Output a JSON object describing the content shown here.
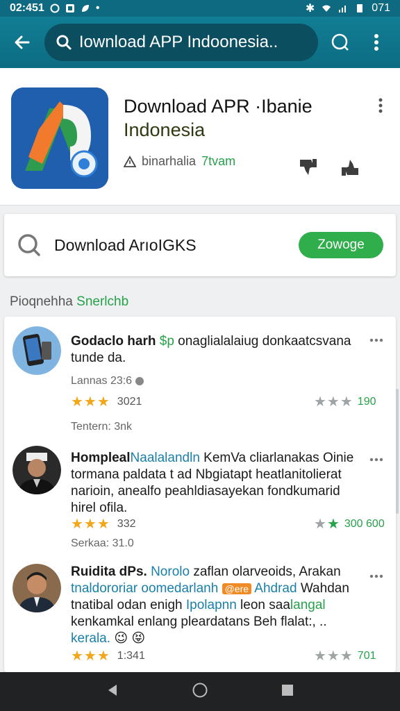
{
  "status": {
    "time": "02:451",
    "battery": "071"
  },
  "appbar": {
    "search_text": "Iownload APP Indoonesia.."
  },
  "app": {
    "title_line1": "Download APR ·Ibanie",
    "title_line2": "Indonesia",
    "meta_text": "binarhalia",
    "meta_highlight": "7tvam"
  },
  "download": {
    "label": "Download ArıoIGKS",
    "button": "Zowoge"
  },
  "section": {
    "title_prefix": "Pioqnehha",
    "title_highlight": "Snerlchb"
  },
  "reviews": [
    {
      "name": "Godaclo harh",
      "highlight": "$p",
      "text": " onaglialalaiug donkaatcsvana tunde da.",
      "meta": "Lannas 23:6",
      "left_rating": "3021",
      "right_rating": "190",
      "footer": "Tentern: 3nk"
    },
    {
      "name": "Hompleal",
      "highlight": "Naalalandln",
      "text": " KemVa cliarlanakas Oinie tormana paldata t ad Nbgiatapt heatlanitolierat narioin, anealfo peahldiasayekan fondkumarid hirel ofila.",
      "meta": "",
      "left_rating": "332",
      "right_rating": "300 600",
      "footer": "Serkaa: 31.0"
    },
    {
      "name": "Ruidita dPs.",
      "highlight": "Norolo",
      "text": " zaflan olarveoids, Arakan",
      "line2_blue": "tnaldororiar oomedarlanh",
      "badge": "@ere",
      "line2_blue2": "Ahdrad",
      "line2_rest": " Wahdan",
      "line3": "tnatibal odan enigh",
      "line3_blue": "Ipolapnn",
      "line3_rest": " leon saa",
      "line3_green": "langal",
      "line4": "kenkamkal enlang pleardatans Beh flalat:, ..",
      "line5_blue": "kerala.",
      "emoji": "😉 😝",
      "left_rating": "1:341",
      "right_rating": "701"
    }
  ]
}
